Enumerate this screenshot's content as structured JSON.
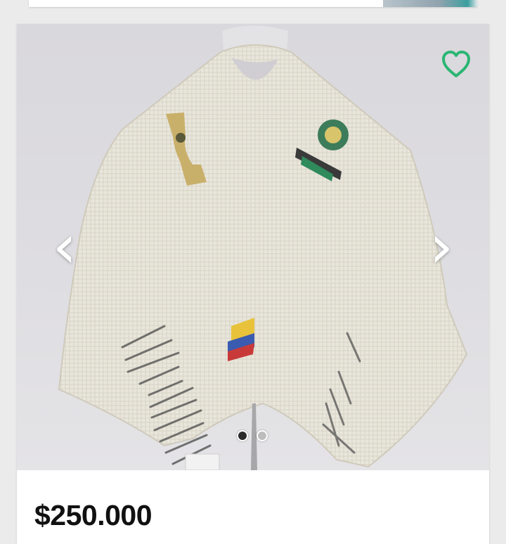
{
  "product": {
    "price": "$250.000",
    "favorite_icon": "heart-outline-icon",
    "accent_color": "#2bb673",
    "gallery": {
      "prev_icon": "‹",
      "next_icon": "›",
      "total_images": 2,
      "active_index": 0
    }
  }
}
